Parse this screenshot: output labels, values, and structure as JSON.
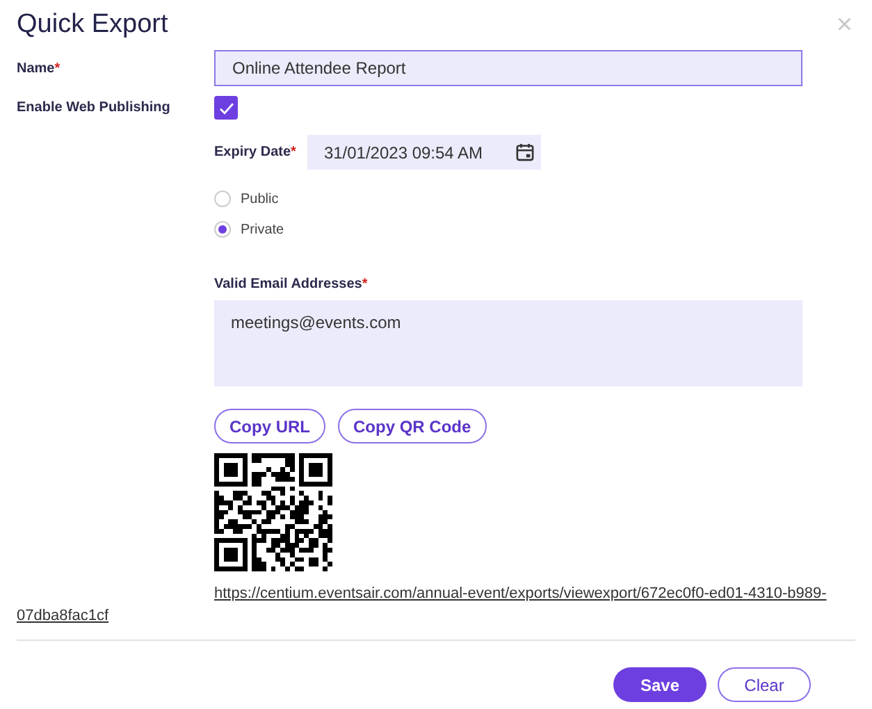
{
  "dialog": {
    "title": "Quick Export",
    "close_glyph": "×"
  },
  "name_field": {
    "label": "Name",
    "required_mark": "*",
    "value": "Online Attendee Report"
  },
  "web_publishing": {
    "label": "Enable Web Publishing",
    "checked": true
  },
  "expiry": {
    "label": "Expiry Date",
    "required_mark": "*",
    "value": "31/01/2023 09:54 AM"
  },
  "visibility": [
    {
      "label": "Public",
      "selected": false
    },
    {
      "label": "Private",
      "selected": true
    }
  ],
  "emails": {
    "label": "Valid Email Addresses",
    "required_mark": "*",
    "value": "meetings@events.com"
  },
  "copy_buttons": [
    "Copy URL",
    "Copy QR Code"
  ],
  "url": "https://centium.eventsair.com/annual-event/exports/viewexport/672ec0f0-ed01-4310-b989-07dba8fac1cf",
  "footer_buttons": [
    {
      "label": "Save",
      "kind": "primary"
    },
    {
      "label": "Clear",
      "kind": "secondary"
    }
  ]
}
